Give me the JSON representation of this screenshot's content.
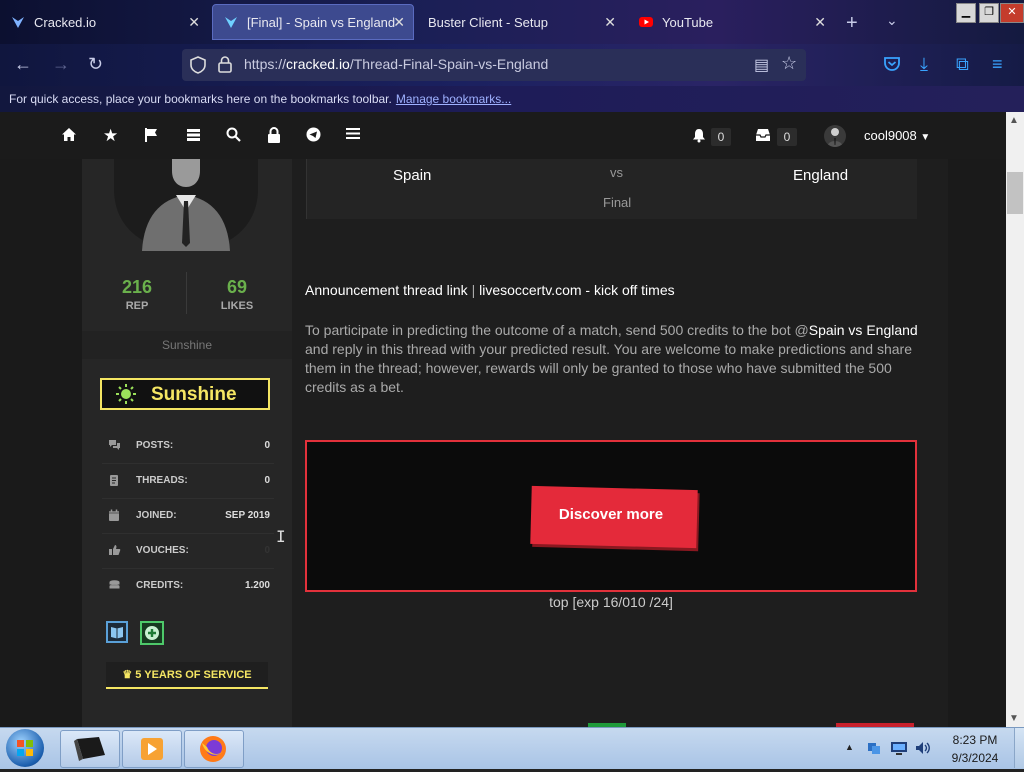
{
  "browser": {
    "tabs": [
      {
        "title": "Cracked.io",
        "active": false
      },
      {
        "title": "[Final] - Spain vs England",
        "active": true
      },
      {
        "title": "Buster Client - Setup",
        "active": false
      },
      {
        "title": "YouTube",
        "active": false
      }
    ],
    "url_prefix": "https://",
    "url_domain": "cracked.io",
    "url_path": "/Thread-Final-Spain-vs-England",
    "bookmarks_text": "For quick access, place your bookmarks here on the bookmarks toolbar.",
    "bookmarks_link": "Manage bookmarks..."
  },
  "sitenav": {
    "notifications_count": "0",
    "inbox_count": "0",
    "username": "cool9008"
  },
  "profile": {
    "rep": "216",
    "rep_label": "REP",
    "likes": "69",
    "likes_label": "LIKES",
    "usertitle": "Sunshine",
    "badge_text": "Sunshine",
    "rows": [
      {
        "label": "POSTS:",
        "value": "0",
        "icon": "comments-icon"
      },
      {
        "label": "THREADS:",
        "value": "0",
        "icon": "document-icon"
      },
      {
        "label": "JOINED:",
        "value": "SEP 2019",
        "icon": "calendar-icon"
      },
      {
        "label": "VOUCHES:",
        "value": "0",
        "icon": "thumbs-up-icon"
      },
      {
        "label": "CREDITS:",
        "value": "1.200",
        "icon": "coins-icon"
      }
    ],
    "service_award": "5 YEARS OF SERVICE"
  },
  "match": {
    "home": "Spain",
    "vs": "vs",
    "away": "England",
    "stage": "Final"
  },
  "post": {
    "link1": "Announcement thread link",
    "separator": "|",
    "link2": "livesoccertv.com - kick off times",
    "para_part1": "To participate in predicting the outcome of a match, send 500 credits to the bot @",
    "para_highlight": "Spain vs England",
    "para_part2": " and reply in this thread with your predicted result. You are welcome to make predictions and share them in the thread; however, rewards will only be granted to those who have submitted the 500 credits as a bet.",
    "ad_button": "Discover more",
    "caption": "top [exp 16/010 /24]"
  },
  "taskbar": {
    "time": "8:23 PM",
    "date": "9/3/2024"
  },
  "colors": {
    "rep_green": "#6ab04c",
    "badge_yellow": "#f5e663",
    "ad_border": "#e2313b",
    "ad_button": "#e42a3a"
  }
}
